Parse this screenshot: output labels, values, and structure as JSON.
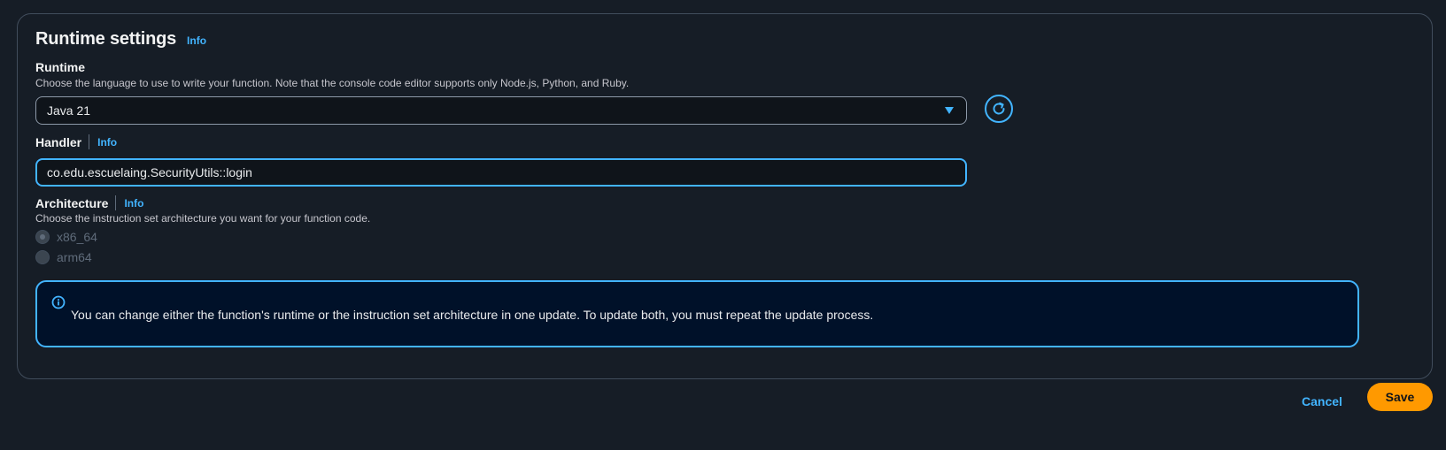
{
  "section": {
    "title": "Runtime settings",
    "info": "Info"
  },
  "runtime": {
    "label": "Runtime",
    "description": "Choose the language to use to write your function. Note that the console code editor supports only Node.js, Python, and Ruby.",
    "selected": "Java 21"
  },
  "handler": {
    "label": "Handler",
    "info": "Info",
    "value": "co.edu.escuelaing.SecurityUtils::login"
  },
  "architecture": {
    "label": "Architecture",
    "info": "Info",
    "description": "Choose the instruction set architecture you want for your function code.",
    "options": [
      {
        "label": "x86_64",
        "checked": true
      },
      {
        "label": "arm64",
        "checked": false
      }
    ]
  },
  "alert": {
    "icon": "info-circle-icon",
    "text": "You can change either the function's runtime or the instruction set architecture in one update. To update both, you must repeat the update process."
  },
  "actions": {
    "cancel": "Cancel",
    "save": "Save"
  },
  "colors": {
    "accent": "#42b4ff",
    "primary_button": "#ff9900",
    "background": "#161d26",
    "alert_background": "#001129"
  }
}
